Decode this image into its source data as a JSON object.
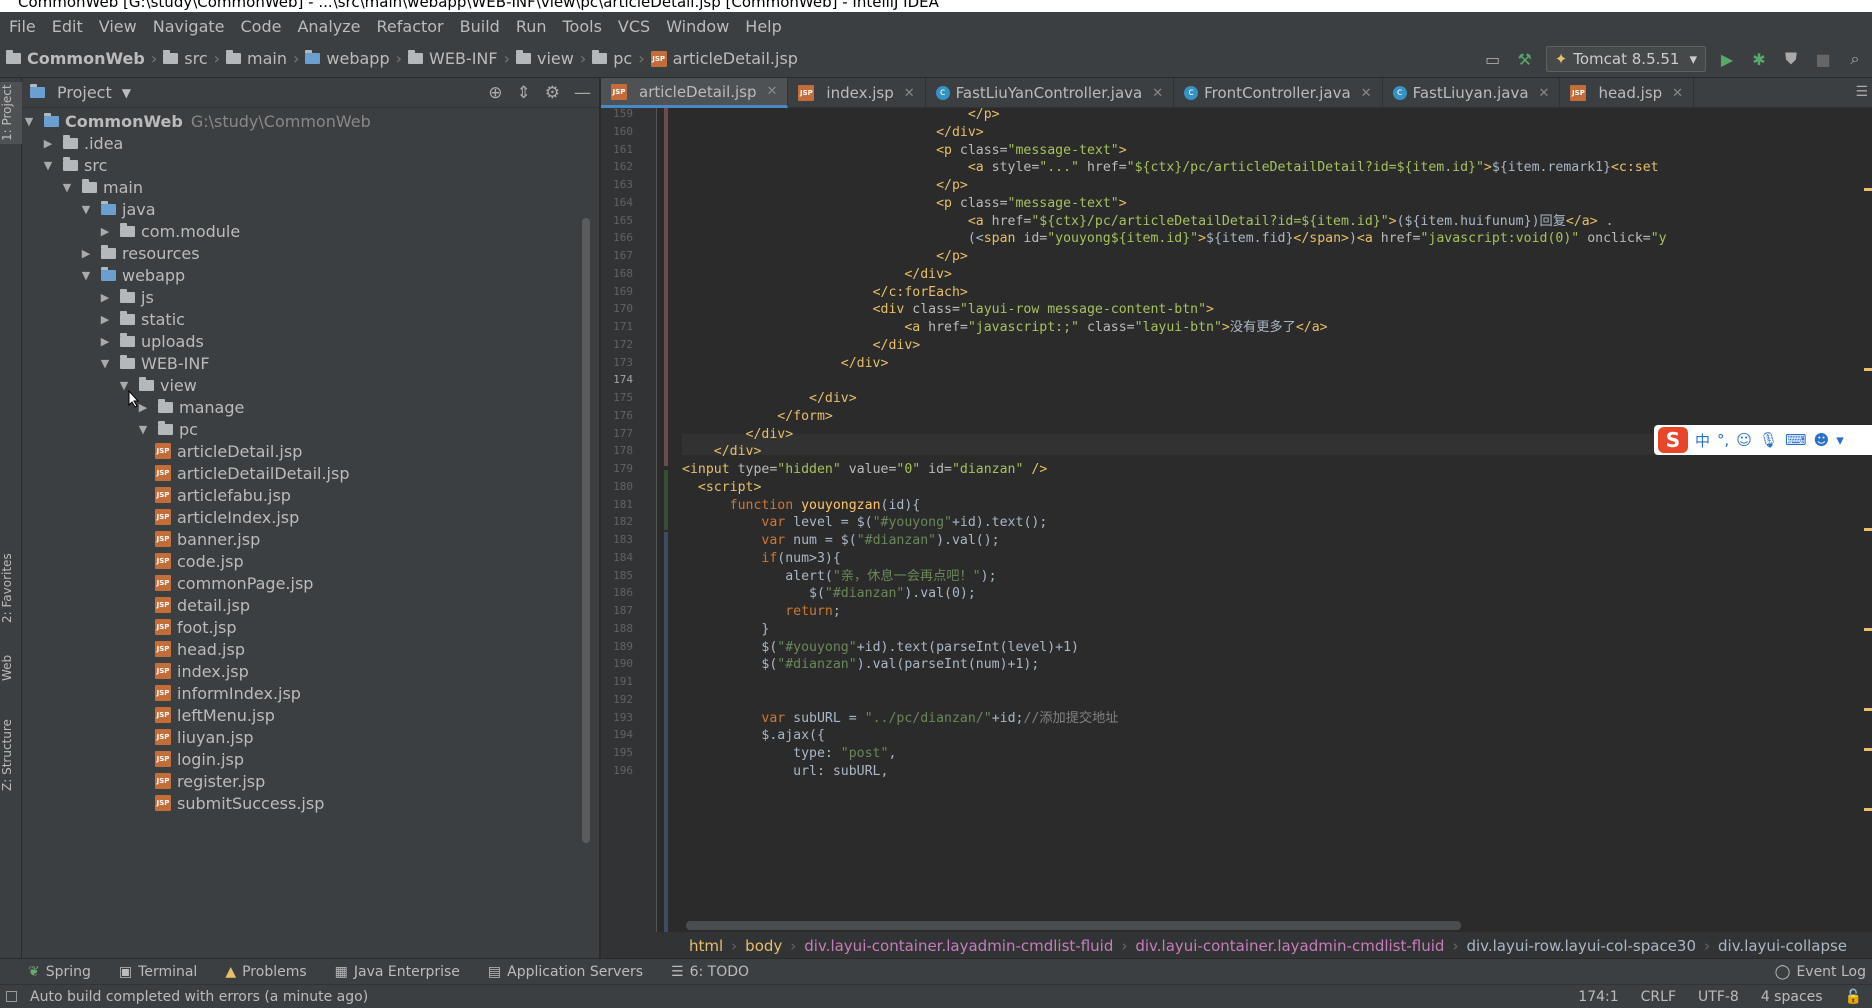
{
  "window": {
    "title": "CommonWeb [G:\\study\\CommonWeb] - ...\\src\\main\\webapp\\WEB-INF\\view\\pc\\articleDetail.jsp [CommonWeb] - IntelliJ IDEA"
  },
  "menu": [
    "File",
    "Edit",
    "View",
    "Navigate",
    "Code",
    "Analyze",
    "Refactor",
    "Build",
    "Run",
    "Tools",
    "VCS",
    "Window",
    "Help"
  ],
  "nav": {
    "crumbs": [
      "CommonWeb",
      "src",
      "main",
      "webapp",
      "WEB-INF",
      "view",
      "pc",
      "articleDetail.jsp"
    ],
    "run_config": "Tomcat 8.5.51"
  },
  "left_strip": [
    "1: Project",
    "2: Favorites",
    "Web",
    "Z: Structure"
  ],
  "project": {
    "title": "Project",
    "root_name": "CommonWeb",
    "root_path": "G:\\study\\CommonWeb",
    "nodes": [
      {
        "label": ".idea",
        "depth": 1,
        "kind": "folder",
        "state": "closed"
      },
      {
        "label": "src",
        "depth": 1,
        "kind": "folder",
        "state": "open"
      },
      {
        "label": "main",
        "depth": 2,
        "kind": "folder",
        "state": "open"
      },
      {
        "label": "java",
        "depth": 3,
        "kind": "folder-blue",
        "state": "open"
      },
      {
        "label": "com.module",
        "depth": 4,
        "kind": "package",
        "state": "closed"
      },
      {
        "label": "resources",
        "depth": 3,
        "kind": "folder",
        "state": "closed"
      },
      {
        "label": "webapp",
        "depth": 3,
        "kind": "folder-blue",
        "state": "open"
      },
      {
        "label": "js",
        "depth": 4,
        "kind": "folder",
        "state": "closed"
      },
      {
        "label": "static",
        "depth": 4,
        "kind": "folder",
        "state": "closed"
      },
      {
        "label": "uploads",
        "depth": 4,
        "kind": "folder",
        "state": "closed"
      },
      {
        "label": "WEB-INF",
        "depth": 4,
        "kind": "folder",
        "state": "open"
      },
      {
        "label": "view",
        "depth": 5,
        "kind": "folder",
        "state": "open"
      },
      {
        "label": "manage",
        "depth": 6,
        "kind": "folder",
        "state": "closed"
      },
      {
        "label": "pc",
        "depth": 6,
        "kind": "folder",
        "state": "open"
      },
      {
        "label": "articleDetail.jsp",
        "depth": 7,
        "kind": "jsp",
        "state": "leaf"
      },
      {
        "label": "articleDetailDetail.jsp",
        "depth": 7,
        "kind": "jsp",
        "state": "leaf"
      },
      {
        "label": "articlefabu.jsp",
        "depth": 7,
        "kind": "jsp",
        "state": "leaf"
      },
      {
        "label": "articleIndex.jsp",
        "depth": 7,
        "kind": "jsp",
        "state": "leaf"
      },
      {
        "label": "banner.jsp",
        "depth": 7,
        "kind": "jsp",
        "state": "leaf"
      },
      {
        "label": "code.jsp",
        "depth": 7,
        "kind": "jsp",
        "state": "leaf"
      },
      {
        "label": "commonPage.jsp",
        "depth": 7,
        "kind": "jsp",
        "state": "leaf"
      },
      {
        "label": "detail.jsp",
        "depth": 7,
        "kind": "jsp",
        "state": "leaf"
      },
      {
        "label": "foot.jsp",
        "depth": 7,
        "kind": "jsp",
        "state": "leaf"
      },
      {
        "label": "head.jsp",
        "depth": 7,
        "kind": "jsp",
        "state": "leaf"
      },
      {
        "label": "index.jsp",
        "depth": 7,
        "kind": "jsp",
        "state": "leaf"
      },
      {
        "label": "informIndex.jsp",
        "depth": 7,
        "kind": "jsp",
        "state": "leaf"
      },
      {
        "label": "leftMenu.jsp",
        "depth": 7,
        "kind": "jsp",
        "state": "leaf"
      },
      {
        "label": "liuyan.jsp",
        "depth": 7,
        "kind": "jsp",
        "state": "leaf"
      },
      {
        "label": "login.jsp",
        "depth": 7,
        "kind": "jsp",
        "state": "leaf"
      },
      {
        "label": "register.jsp",
        "depth": 7,
        "kind": "jsp",
        "state": "leaf"
      },
      {
        "label": "submitSuccess.jsp",
        "depth": 7,
        "kind": "jsp",
        "state": "leaf"
      }
    ]
  },
  "tabs": [
    {
      "label": "articleDetail.jsp",
      "kind": "jsp",
      "active": true
    },
    {
      "label": "index.jsp",
      "kind": "jsp",
      "active": false
    },
    {
      "label": "FastLiuYanController.java",
      "kind": "class",
      "active": false
    },
    {
      "label": "FrontController.java",
      "kind": "class",
      "active": false
    },
    {
      "label": "FastLiuyan.java",
      "kind": "class",
      "active": false
    },
    {
      "label": "head.jsp",
      "kind": "jsp",
      "active": false
    }
  ],
  "editor": {
    "first_line": 159,
    "current_line": 174,
    "lines": [
      [
        [
          "tx",
          "                                    "
        ],
        [
          "tg",
          "</p>"
        ]
      ],
      [
        [
          "tx",
          "                                "
        ],
        [
          "tg",
          "</div>"
        ]
      ],
      [
        [
          "tx",
          "                                "
        ],
        [
          "tg",
          "<p "
        ],
        [
          "at",
          "class="
        ],
        [
          "av",
          "\"message-text\""
        ],
        [
          "tg",
          ">"
        ]
      ],
      [
        [
          "tx",
          "                                    "
        ],
        [
          "tg",
          "<a "
        ],
        [
          "at",
          "style="
        ],
        [
          "av",
          "\"...\""
        ],
        [
          "at",
          " href="
        ],
        [
          "av",
          "\"${ctx}/pc/articleDetailDetail?id=${item.id}\""
        ],
        [
          "tg",
          ">"
        ],
        [
          "tx",
          "${item.remark1}"
        ],
        [
          "tg",
          "<c:set"
        ]
      ],
      [
        [
          "tx",
          "                                "
        ],
        [
          "tg",
          "</p>"
        ]
      ],
      [
        [
          "tx",
          "                                "
        ],
        [
          "tg",
          "<p "
        ],
        [
          "at",
          "class="
        ],
        [
          "av",
          "\"message-text\""
        ],
        [
          "tg",
          ">"
        ]
      ],
      [
        [
          "tx",
          "                                    "
        ],
        [
          "tg",
          "<a "
        ],
        [
          "at",
          "href="
        ],
        [
          "av",
          "\"${ctx}/pc/articleDetailDetail?id=${item.id}\""
        ],
        [
          "tg",
          ">"
        ],
        [
          "tx",
          "(${item.huifunum})回复"
        ],
        [
          "tg",
          "</a>"
        ],
        [
          "tx",
          " ."
        ]
      ],
      [
        [
          "tx",
          "                                    (<"
        ],
        [
          "tg",
          "span "
        ],
        [
          "at",
          "id="
        ],
        [
          "av",
          "\"youyong${item.id}\""
        ],
        [
          "tg",
          ">"
        ],
        [
          "tx",
          "${item.fid}"
        ],
        [
          "tg",
          "</span>"
        ],
        [
          "tx",
          ")"
        ],
        [
          "tg",
          "<a "
        ],
        [
          "at",
          "href="
        ],
        [
          "av",
          "\"javascript:void(0)\""
        ],
        [
          "at",
          " onclick="
        ],
        [
          "av",
          "\"y"
        ]
      ],
      [
        [
          "tx",
          "                                "
        ],
        [
          "tg",
          "</p>"
        ]
      ],
      [
        [
          "tx",
          "                            "
        ],
        [
          "tg",
          "</div>"
        ]
      ],
      [
        [
          "tx",
          "                        "
        ],
        [
          "tg",
          "</c:forEach>"
        ]
      ],
      [
        [
          "tx",
          "                        "
        ],
        [
          "tg",
          "<div "
        ],
        [
          "at",
          "class="
        ],
        [
          "av",
          "\"layui-row message-content-btn\""
        ],
        [
          "tg",
          ">"
        ]
      ],
      [
        [
          "tx",
          "                            "
        ],
        [
          "tg",
          "<a "
        ],
        [
          "at",
          "href="
        ],
        [
          "av",
          "\"javascript:;\""
        ],
        [
          "at",
          " class="
        ],
        [
          "av",
          "\"layui-btn\""
        ],
        [
          "tg",
          ">"
        ],
        [
          "tx",
          "没有更多了"
        ],
        [
          "tg",
          "</a>"
        ]
      ],
      [
        [
          "tx",
          "                        "
        ],
        [
          "tg",
          "</div>"
        ]
      ],
      [
        [
          "tx",
          "                    "
        ],
        [
          "tg",
          "</div>"
        ]
      ],
      [
        [
          "tx",
          ""
        ]
      ],
      [
        [
          "tx",
          "                "
        ],
        [
          "tg",
          "</div>"
        ]
      ],
      [
        [
          "tx",
          "            "
        ],
        [
          "tg",
          "</form>"
        ]
      ],
      [
        [
          "tx",
          "        "
        ],
        [
          "tg",
          "</div>"
        ]
      ],
      [
        [
          "tx",
          "    "
        ],
        [
          "tg",
          "</div>"
        ]
      ],
      [
        [
          "tg",
          "<input "
        ],
        [
          "at",
          "type="
        ],
        [
          "av",
          "\"hidden\""
        ],
        [
          "at",
          " value="
        ],
        [
          "av",
          "\"0\""
        ],
        [
          "at",
          " id="
        ],
        [
          "av",
          "\"dianzan\""
        ],
        [
          "tg",
          " />"
        ]
      ],
      [
        [
          "tx",
          "  "
        ],
        [
          "tg",
          "<script>"
        ]
      ],
      [
        [
          "tx",
          "      "
        ],
        [
          "kw",
          "function "
        ],
        [
          "fn",
          "youyongzan"
        ],
        [
          "tx",
          "(id){"
        ]
      ],
      [
        [
          "tx",
          "          "
        ],
        [
          "kw",
          "var "
        ],
        [
          "tx",
          "level = $("
        ],
        [
          "st",
          "\"#youyong\""
        ],
        [
          "tx",
          "+id).text();"
        ]
      ],
      [
        [
          "tx",
          "          "
        ],
        [
          "kw",
          "var "
        ],
        [
          "tx",
          "num = $("
        ],
        [
          "st",
          "\"#dianzan\""
        ],
        [
          "tx",
          ").val();"
        ]
      ],
      [
        [
          "tx",
          "          "
        ],
        [
          "kw",
          "if"
        ],
        [
          "tx",
          "(num>3){"
        ]
      ],
      [
        [
          "tx",
          "             alert("
        ],
        [
          "st",
          "\"亲，休息一会再点吧！\""
        ],
        [
          "tx",
          ");"
        ]
      ],
      [
        [
          "tx",
          "                $("
        ],
        [
          "st",
          "\"#dianzan\""
        ],
        [
          "tx",
          ").val(0);"
        ]
      ],
      [
        [
          "tx",
          "             "
        ],
        [
          "kw",
          "return"
        ],
        [
          "tx",
          ";"
        ]
      ],
      [
        [
          "tx",
          "          }"
        ]
      ],
      [
        [
          "tx",
          "          $("
        ],
        [
          "st",
          "\"#youyong\""
        ],
        [
          "tx",
          "+id).text(parseInt(level)+1)"
        ]
      ],
      [
        [
          "tx",
          "          $("
        ],
        [
          "st",
          "\"#dianzan\""
        ],
        [
          "tx",
          ").val(parseInt(num)+1);"
        ]
      ],
      [
        [
          "tx",
          ""
        ]
      ],
      [
        [
          "tx",
          ""
        ]
      ],
      [
        [
          "tx",
          "          "
        ],
        [
          "kw",
          "var "
        ],
        [
          "tx",
          "subURL = "
        ],
        [
          "st",
          "\"../pc/dianzan/\""
        ],
        [
          "tx",
          "+id;"
        ],
        [
          "cm",
          "//添加提交地址"
        ]
      ],
      [
        [
          "tx",
          "          $.ajax({"
        ]
      ],
      [
        [
          "tx",
          "              type: "
        ],
        [
          "st",
          "\"post\""
        ],
        [
          "tx",
          ","
        ]
      ],
      [
        [
          "tx",
          "              url: subURL,"
        ]
      ]
    ]
  },
  "ime_label": "中",
  "path_bar": [
    "html",
    "body",
    "div.layui-container.layadmin-cmdlist-fluid",
    "div.layui-container.layadmin-cmdlist-fluid",
    "div.layui-row.layui-col-space30",
    "div.layui-collapse"
  ],
  "tool_windows": [
    "Spring",
    "Terminal",
    "Problems",
    "Java Enterprise",
    "Application Servers",
    "6: TODO"
  ],
  "event_log": "Event Log",
  "status": {
    "message": "Auto build completed with errors (a minute ago)",
    "position": "174:1",
    "line_sep": "CRLF",
    "encoding": "UTF-8",
    "indent": "4 spaces"
  },
  "colors": {
    "accent": "#4a88c7",
    "tag": "#e8bf6a",
    "string": "#6a8759",
    "keyword": "#cc7832"
  }
}
